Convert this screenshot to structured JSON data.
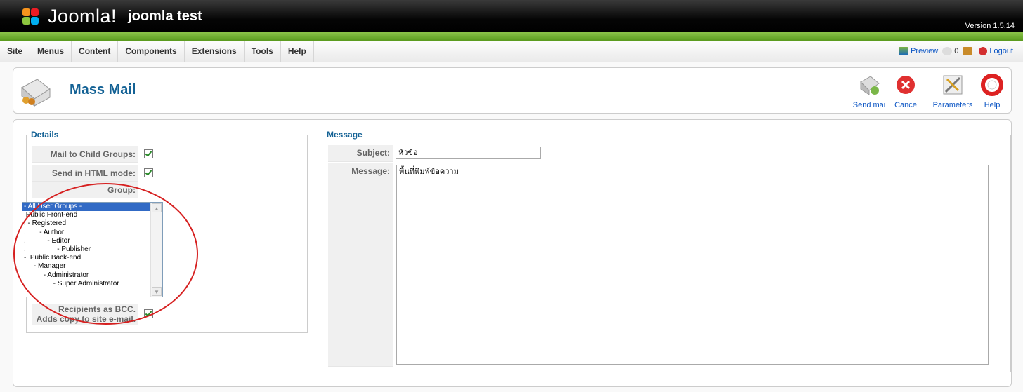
{
  "header": {
    "logo_text": "Joomla!",
    "site_name": "joomla test",
    "version": "Version 1.5.14"
  },
  "menu": [
    "Site",
    "Menus",
    "Content",
    "Components",
    "Extensions",
    "Tools",
    "Help"
  ],
  "status": {
    "preview": "Preview",
    "messages_count": "0",
    "users_count": "",
    "logout": "Logout"
  },
  "page": {
    "title": "Mass Mail"
  },
  "toolbar": {
    "send": "Send mai",
    "cancel": "Cance",
    "parameters": "Parameters",
    "help": "Help"
  },
  "details": {
    "legend": "Details",
    "mail_child_label": "Mail to Child Groups:",
    "html_mode_label": "Send in HTML mode:",
    "group_label": "Group:",
    "groups": [
      "- All User Groups -",
      " Public Front-end",
      ". - Registered",
      ".       - Author",
      ".           - Editor",
      ".                - Publisher",
      "-  Public Back-end",
      "     - Manager",
      "          - Administrator",
      "               - Super Administrator"
    ],
    "bcc_label_1": "Recipients as BCC.",
    "bcc_label_2": "Adds copy to site e-mail."
  },
  "message": {
    "legend": "Message",
    "subject_label": "Subject:",
    "subject_value": "หัวข้อ",
    "message_label": "Message:",
    "message_value": "พื้นที่พิมพ์ข้อความ"
  },
  "colors": {
    "accent_green": "#5a9a1e",
    "title_blue": "#146295",
    "link_blue": "#0b55c4",
    "annotation_red": "#d62020"
  }
}
